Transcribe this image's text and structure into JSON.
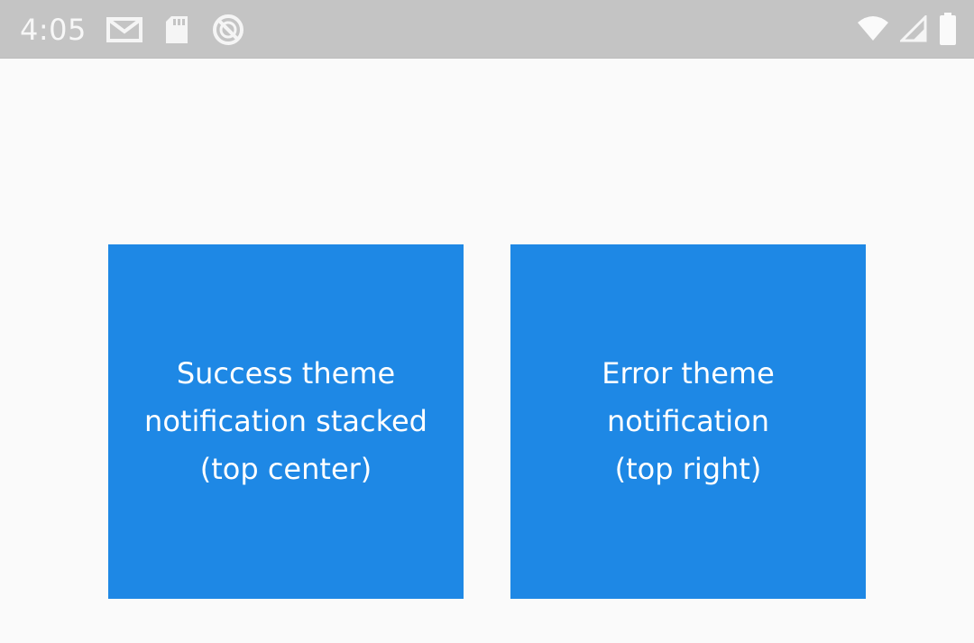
{
  "status_bar": {
    "time": "4:05",
    "left_icons": [
      "gmail-icon",
      "sd-card-icon",
      "no-disturb-icon"
    ],
    "right_icons": [
      "wifi-icon",
      "cellular-signal-icon",
      "battery-icon"
    ]
  },
  "colors": {
    "status_bar_bg": "#c4c4c4",
    "page_bg": "#fafafa",
    "tile_bg": "#1e88e5",
    "tile_text": "#ffffff"
  },
  "tiles": [
    {
      "label": "Success theme\nnotification stacked\n(top center)"
    },
    {
      "label": "Error theme\nnotification\n(top right)"
    }
  ]
}
